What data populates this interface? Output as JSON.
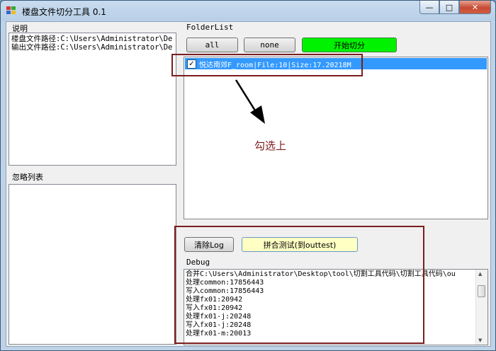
{
  "window": {
    "title": "楼盘文件切分工具 0.1"
  },
  "left": {
    "desc_label": "说明",
    "desc_lines": [
      "楼盘文件路径:C:\\Users\\Administrator\\De",
      "输出文件路径:C:\\Users\\Administrator\\De"
    ],
    "ignore_label": "忽略列表"
  },
  "folder": {
    "label": "FolderList",
    "all_label": "all",
    "none_label": "none",
    "start_label": "开始切分",
    "items": [
      {
        "checked": "✓",
        "text": "悦达南郊F_room|File:10|Size:17.20218M"
      }
    ],
    "annotation": "勾选上"
  },
  "log": {
    "clear_label": "清除Log",
    "merge_label": "拼合测试(到outtest)",
    "debug_label": "Debug",
    "lines": [
      "合并C:\\Users\\Administrator\\Desktop\\tool\\切割工具代码\\切割工具代码\\ou",
      "处理common:17856443",
      "写入common:17856443",
      "处理fx01:20942",
      "写入fx01:20942",
      "处理fx01-j:20248",
      "写入fx01-j:20248",
      "处理fx01-m:20013"
    ]
  },
  "colors": {
    "start_button": "#00f200",
    "merge_button": "#ffffc4",
    "selection": "#3399ff",
    "annotation": "#7b1e1e"
  }
}
